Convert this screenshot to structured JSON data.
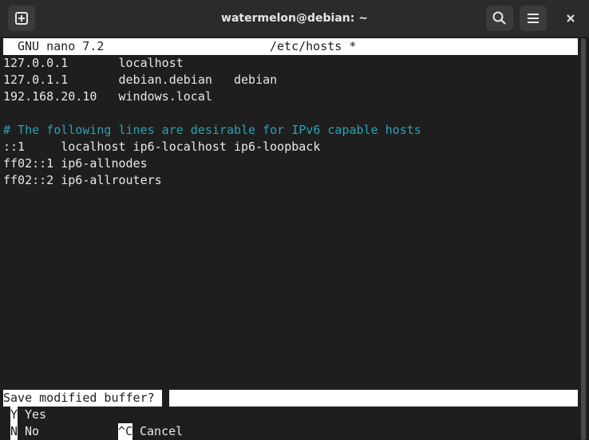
{
  "window": {
    "title": "watermelon@debian: ~"
  },
  "nano": {
    "version": "GNU nano 7.2",
    "filename": "/etc/hosts *"
  },
  "buffer": {
    "lines": [
      "127.0.0.1       localhost",
      "127.0.1.1       debian.debian   debian",
      "192.168.20.10   windows.local",
      "",
      "# The following lines are desirable for IPv6 capable hosts",
      "::1     localhost ip6-localhost ip6-loopback",
      "ff02::1 ip6-allnodes",
      "ff02::2 ip6-allrouters"
    ]
  },
  "prompt": {
    "question": "Save modified buffer?"
  },
  "options": [
    {
      "key": "Y",
      "label": "Yes"
    },
    {
      "key": "N",
      "label": "No"
    },
    {
      "key": "^C",
      "label": "Cancel"
    }
  ],
  "colors": {
    "background": "#1e1e1e",
    "titlebar": "#2b2b2b",
    "comment": "#2aa1b3",
    "text": "#e8e8e8",
    "inverse": "#ffffff"
  },
  "icons": [
    "new-tab-icon",
    "search-icon",
    "hamburger-menu-icon",
    "close-icon"
  ]
}
